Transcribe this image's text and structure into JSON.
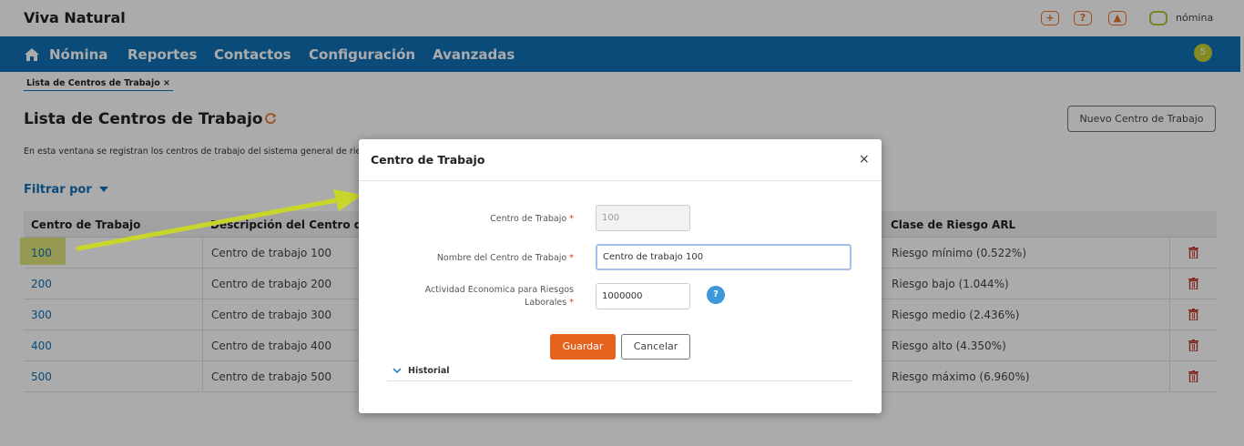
{
  "app": {
    "name": "Viva Natural",
    "product": "nómina",
    "notifications": "5"
  },
  "header_icons": [
    "plus-icon",
    "help-icon",
    "user-icon"
  ],
  "nav": {
    "items": [
      "Nómina",
      "Reportes",
      "Contactos",
      "Configuración",
      "Avanzadas"
    ]
  },
  "breadcrumb": {
    "tab": "Lista de Centros de Trabajo ×"
  },
  "page": {
    "title": "Lista de Centros de Trabajo",
    "new_button": "Nuevo Centro de Trabajo",
    "description": "En esta ventana se registran los centros de trabajo del sistema general de ries",
    "filter_label": "Filtrar por"
  },
  "table": {
    "headers": {
      "c1": "Centro de Trabajo",
      "c2": "Descripción del Centro de Tr",
      "c3": "Clase de Riesgo ARL"
    },
    "rows": [
      {
        "code": "100",
        "desc": "Centro de trabajo 100",
        "risk": "Riesgo mínimo (0.522%)"
      },
      {
        "code": "200",
        "desc": "Centro de trabajo 200",
        "risk": "Riesgo bajo (1.044%)"
      },
      {
        "code": "300",
        "desc": "Centro de trabajo 300",
        "risk": "Riesgo medio (2.436%)"
      },
      {
        "code": "400",
        "desc": "Centro de trabajo 400",
        "risk": "Riesgo alto (4.350%)"
      },
      {
        "code": "500",
        "desc": "Centro de trabajo 500",
        "risk": "Riesgo máximo (6.960%)"
      }
    ]
  },
  "modal": {
    "title": "Centro de Trabajo",
    "close": "×",
    "fields": {
      "code": {
        "label": "Centro de Trabajo",
        "value": "100"
      },
      "name": {
        "label": "Nombre del Centro de Trabajo",
        "value": "Centro de trabajo 100"
      },
      "activity": {
        "label_line1": "Actividad Economica para Riesgos",
        "label_line2": "Laborales",
        "value": "1000000"
      }
    },
    "required_mark": "*",
    "help": "?",
    "save": "Guardar",
    "cancel": "Cancelar",
    "history": "Historial"
  },
  "colors": {
    "primary": "#1170b5",
    "accent": "#e5631f",
    "highlight": "#c5d132",
    "danger": "#c0392b"
  }
}
